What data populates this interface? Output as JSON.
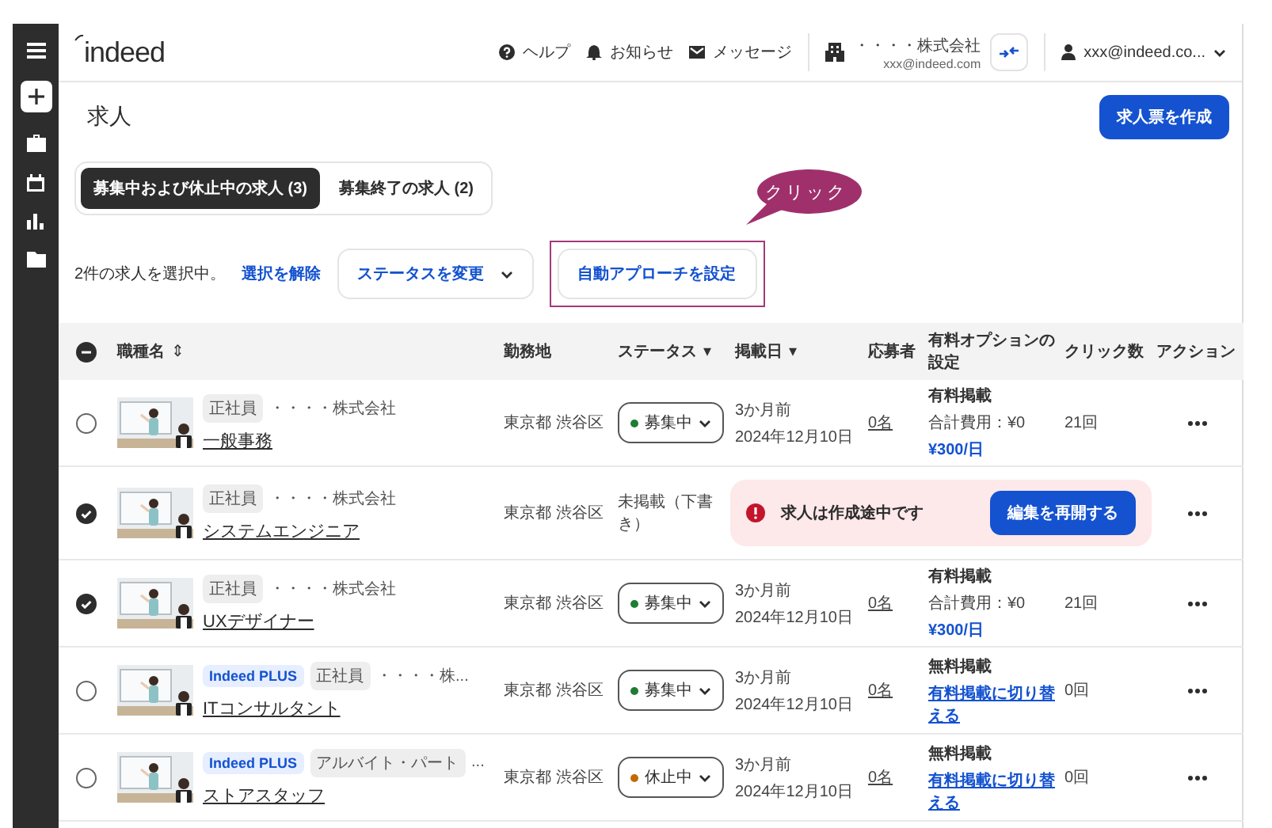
{
  "header": {
    "logo": "indeed",
    "links": [
      {
        "kind": "help",
        "label": "ヘルプ"
      },
      {
        "kind": "notifications",
        "label": "お知らせ"
      },
      {
        "kind": "messages",
        "label": "メッセージ"
      }
    ],
    "company": {
      "name": "・・・・株式会社",
      "email": "xxx@indeed.com"
    },
    "account": "xxx@indeed.co..."
  },
  "page": {
    "title": "求人",
    "create_button": "求人票を作成"
  },
  "tabs": [
    {
      "label": "募集中および休止中の求人 (3)",
      "selected": true
    },
    {
      "label": "募集終了の求人 (2)",
      "selected": false
    }
  ],
  "selection": {
    "summary": "2件の求人を選択中。",
    "clear_link": "選択を解除",
    "status_button": "ステータスを変更",
    "auto_button": {
      "label": "自動アプローチを設定",
      "highlighted": true
    }
  },
  "callout": "クリック",
  "table": {
    "select_all": {
      "indeterminate": true
    },
    "columns": [
      {
        "label": "職種名",
        "sort_icon": "⇕"
      },
      {
        "label": "勤務地"
      },
      {
        "label": "ステータス",
        "sort_icon": "▾"
      },
      {
        "label": "掲載日",
        "sort_icon": "▾"
      },
      {
        "label": "応募者"
      },
      {
        "label": "有料オプションの設定"
      },
      {
        "label": "クリック数"
      },
      {
        "label": "アクション"
      }
    ],
    "rows": [
      {
        "kind": "listing",
        "checked": false,
        "tags": [
          {
            "kind": "plain",
            "label": "正社員"
          }
        ],
        "company": "・・・・株式会社",
        "title": "一般事務",
        "location": "東京都 渋谷区",
        "status": {
          "label": "募集中",
          "color": "#1e7d32"
        },
        "posted": {
          "relative": "3か月前",
          "date": "2024年12月10日"
        },
        "applicants": "0名",
        "option": {
          "label": "有料掲載",
          "cost": "合計費用：¥0",
          "link": "¥300/日"
        },
        "clicks": "21回"
      },
      {
        "kind": "draft",
        "checked": true,
        "tags": [
          {
            "kind": "plain",
            "label": "正社員"
          }
        ],
        "company": "・・・・株式会社",
        "title": "システムエンジニア",
        "location": "東京都 渋谷区",
        "status_text": "未掲載（下書き）",
        "notice": {
          "message": "求人は作成途中です",
          "button": "編集を再開する"
        }
      },
      {
        "kind": "listing",
        "checked": true,
        "tags": [
          {
            "kind": "plain",
            "label": "正社員"
          }
        ],
        "company": "・・・・株式会社",
        "title": "UXデザイナー",
        "location": "東京都 渋谷区",
        "status": {
          "label": "募集中",
          "color": "#1e7d32"
        },
        "posted": {
          "relative": "3か月前",
          "date": "2024年12月10日"
        },
        "applicants": "0名",
        "option": {
          "label": "有料掲載",
          "cost": "合計費用：¥0",
          "link": "¥300/日"
        },
        "clicks": "21回"
      },
      {
        "kind": "listing",
        "checked": false,
        "tags": [
          {
            "kind": "plus",
            "label": "Indeed PLUS"
          },
          {
            "kind": "plain",
            "label": "正社員"
          }
        ],
        "company": "・・・・株...",
        "title": "ITコンサルタント",
        "location": "東京都 渋谷区",
        "status": {
          "label": "募集中",
          "color": "#1e7d32"
        },
        "posted": {
          "relative": "3か月前",
          "date": "2024年12月10日"
        },
        "applicants": "0名",
        "option": {
          "label": "無料掲載",
          "link": "有料掲載に切り替える"
        },
        "clicks": "0回"
      },
      {
        "kind": "listing",
        "checked": false,
        "tags": [
          {
            "kind": "plus",
            "label": "Indeed PLUS"
          },
          {
            "kind": "plain",
            "label": "アルバイト・パート"
          }
        ],
        "company": "...",
        "title": "ストアスタッフ",
        "location": "東京都 渋谷区",
        "status": {
          "label": "休止中",
          "color": "#c26a00"
        },
        "posted": {
          "relative": "3か月前",
          "date": "2024年12月10日"
        },
        "applicants": "0名",
        "option": {
          "label": "無料掲載",
          "link": "有料掲載に切り替える"
        },
        "clicks": "0回"
      }
    ]
  }
}
